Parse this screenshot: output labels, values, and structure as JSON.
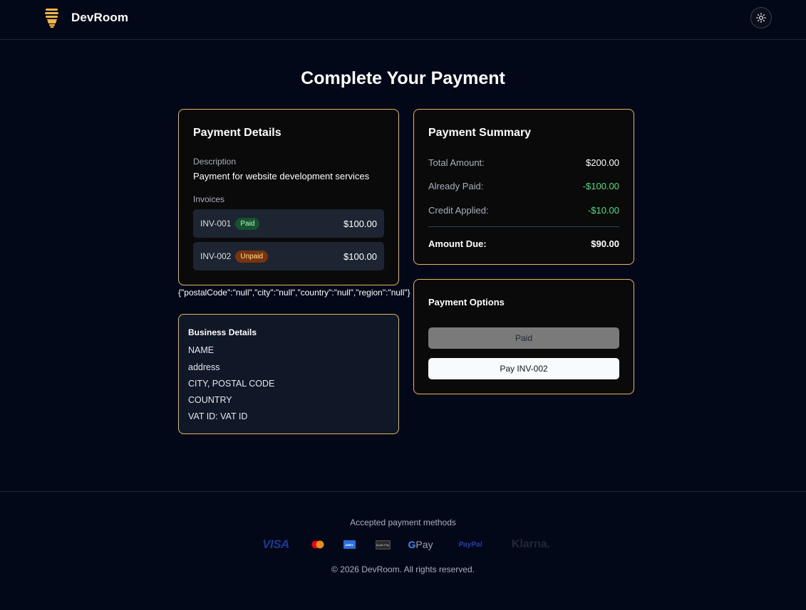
{
  "header": {
    "brand_name": "DevRoom",
    "logo_icon": "lightbulb-icon",
    "theme_toggle_icon": "sun-icon"
  },
  "page": {
    "title": "Complete Your Payment"
  },
  "payment_details": {
    "title": "Payment Details",
    "description_label": "Description",
    "description": "Payment for website development services",
    "invoices_label": "Invoices",
    "invoices": [
      {
        "id": "INV-001",
        "status": "Paid",
        "amount": "$100.00"
      },
      {
        "id": "INV-002",
        "status": "Unpaid",
        "amount": "$100.00"
      }
    ]
  },
  "debug_json_text": "{\"postalCode\":\"null\",\"city\":\"null\",\"country\":\"null\",\"region\":\"null\"}",
  "business_details": {
    "title": "Business Details",
    "name": "NAME",
    "address": "address",
    "city_postal": "CITY, POSTAL CODE",
    "country": "COUNTRY",
    "vat": "VAT ID: VAT ID"
  },
  "payment_summary": {
    "title": "Payment Summary",
    "total_label": "Total Amount:",
    "total_value": "$200.00",
    "paid_label": "Already Paid:",
    "paid_value": "-$100.00",
    "credit_label": "Credit Applied:",
    "credit_value": "-$10.00",
    "due_label": "Amount Due:",
    "due_value": "$90.00"
  },
  "payment_options": {
    "title": "Payment Options",
    "paid_button": "Paid",
    "pay_button": "Pay INV-002"
  },
  "footer": {
    "accepted_label": "Accepted payment methods",
    "methods": {
      "visa": "VISA",
      "amex": "AMEX",
      "applepay": "Apple Pay",
      "gpay_g": "G",
      "gpay_rest": " Pay",
      "paypal": "PayPal",
      "klarna": "Klarna."
    },
    "copyright": "© 2026 DevRoom. All rights reserved."
  },
  "colors": {
    "background": "#020817",
    "accent_border": "#e7b85a",
    "positive": "#4ade80"
  }
}
